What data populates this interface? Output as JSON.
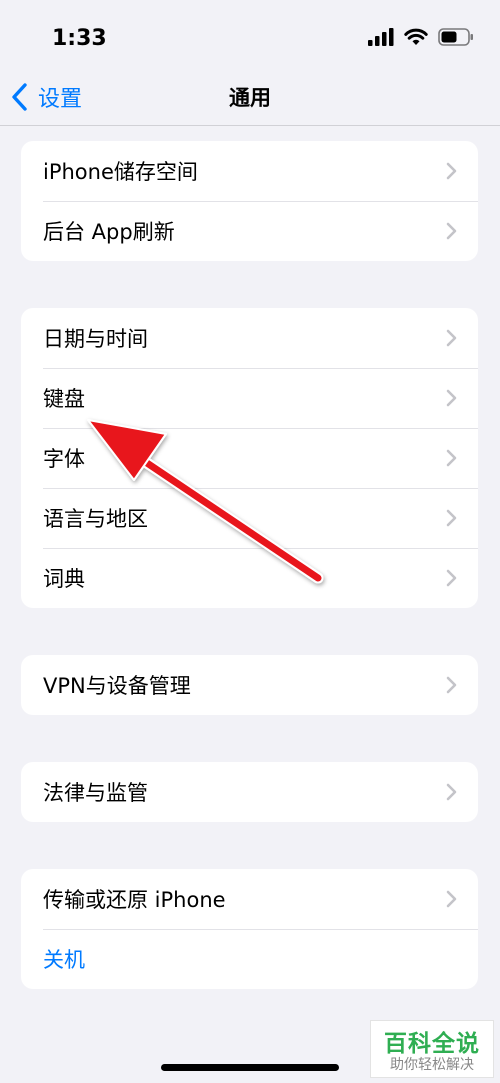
{
  "status_bar": {
    "time": "1:33"
  },
  "nav": {
    "back_label": "设置",
    "title": "通用"
  },
  "groups": [
    {
      "items": [
        {
          "label": "iPhone储存空间"
        },
        {
          "label": "后台 App刷新"
        }
      ]
    },
    {
      "items": [
        {
          "label": "日期与时间"
        },
        {
          "label": "键盘"
        },
        {
          "label": "字体"
        },
        {
          "label": "语言与地区"
        },
        {
          "label": "词典"
        }
      ]
    },
    {
      "items": [
        {
          "label": "VPN与设备管理"
        }
      ]
    },
    {
      "items": [
        {
          "label": "法律与监管"
        }
      ]
    },
    {
      "items": [
        {
          "label": "传输或还原 iPhone"
        },
        {
          "label": "关机"
        }
      ]
    }
  ],
  "annotation": {
    "arrow_color": "#e8141b",
    "points_to": "键盘"
  },
  "watermark": {
    "title": "百科全说",
    "subtitle": "助你轻松解决"
  },
  "colors": {
    "accent": "#007aff",
    "background": "#f2f2f7",
    "watermark_green": "#2fae52"
  },
  "icons": [
    "back-chevron-icon",
    "signal-icon",
    "wifi-icon",
    "battery-icon",
    "chevron-right-icon"
  ]
}
